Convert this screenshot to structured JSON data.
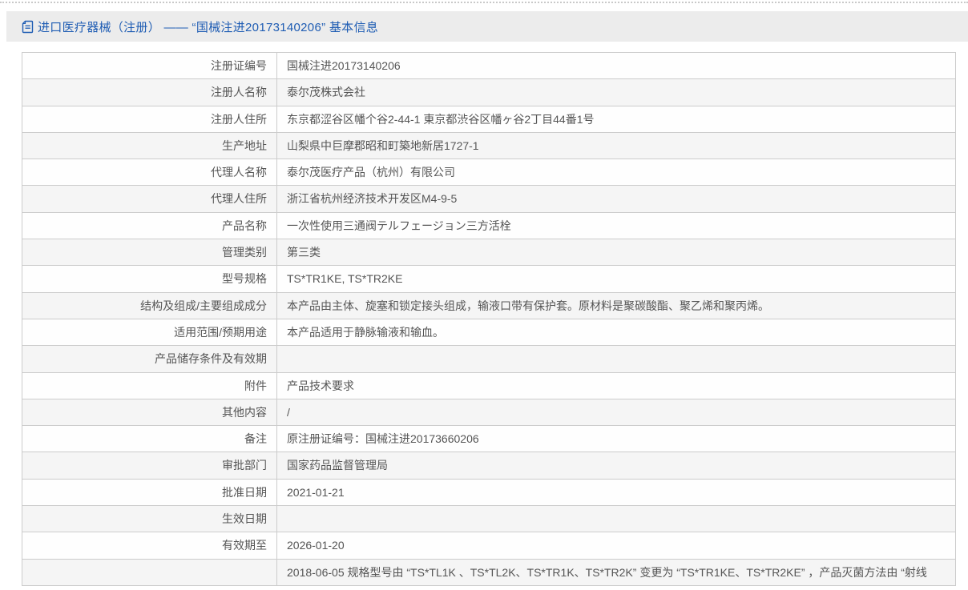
{
  "header": {
    "icon": "document-icon",
    "title": "进口医疗器械（注册） —— “国械注进20173140206” 基本信息"
  },
  "colors": {
    "accent_blue": "#1e5cb3",
    "header_bar_bg": "#ececec",
    "row_alt_bg": "#f5f5f5",
    "table_border": "#cccccc",
    "text_gray": "#555555"
  },
  "table": {
    "rows": [
      {
        "label": "注册证编号",
        "value": "国械注进20173140206"
      },
      {
        "label": "注册人名称",
        "value": "泰尔茂株式会社"
      },
      {
        "label": "注册人住所",
        "value": "东京都涩谷区幡个谷2-44-1 東京都渋谷区幡ヶ谷2丁目44番1号"
      },
      {
        "label": "生产地址",
        "value": "山梨県中巨摩郡昭和町築地新居1727-1"
      },
      {
        "label": "代理人名称",
        "value": "泰尔茂医疗产品（杭州）有限公司"
      },
      {
        "label": "代理人住所",
        "value": "浙江省杭州经济技术开发区M4-9-5"
      },
      {
        "label": "产品名称",
        "value": "一次性使用三通阀テルフェージョン三方活栓"
      },
      {
        "label": "管理类别",
        "value": "第三类"
      },
      {
        "label": "型号规格",
        "value": "TS*TR1KE, TS*TR2KE"
      },
      {
        "label": "结构及组成/主要组成成分",
        "value": "本产品由主体、旋塞和锁定接头组成，输液口带有保护套。原材料是聚碳酸酯、聚乙烯和聚丙烯。"
      },
      {
        "label": "适用范围/预期用途",
        "value": "本产品适用于静脉输液和输血。"
      },
      {
        "label": "产品储存条件及有效期",
        "value": ""
      },
      {
        "label": "附件",
        "value": "产品技术要求"
      },
      {
        "label": "其他内容",
        "value": "/"
      },
      {
        "label": "备注",
        "value": "原注册证编号：国械注进20173660206"
      },
      {
        "label": "审批部门",
        "value": "国家药品监督管理局"
      },
      {
        "label": "批准日期",
        "value": "2021-01-21"
      },
      {
        "label": "生效日期",
        "value": ""
      },
      {
        "label": "有效期至",
        "value": "2026-01-20"
      },
      {
        "label": "",
        "value": "2018-06-05 规格型号由 “TS*TL1K 、TS*TL2K、TS*TR1K、TS*TR2K” 变更为 “TS*TR1KE、TS*TR2KE” ，产品灭菌方法由 “射线"
      }
    ]
  }
}
